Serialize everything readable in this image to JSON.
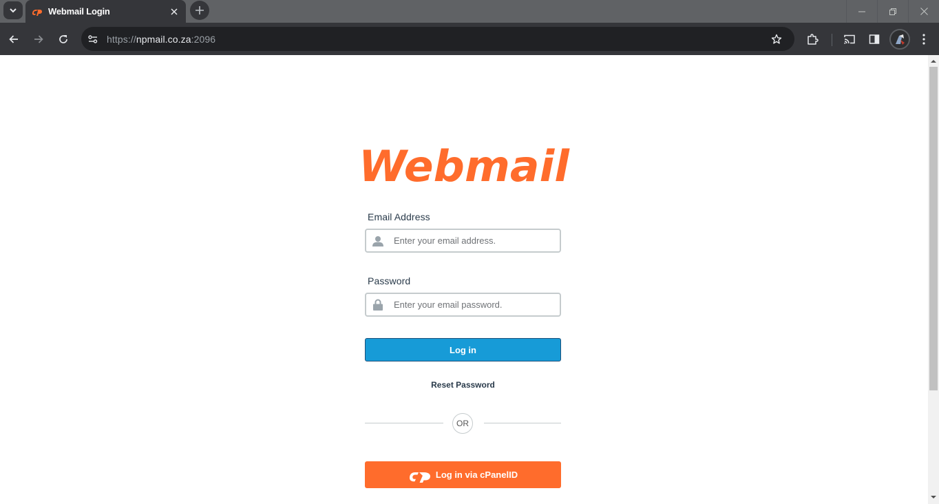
{
  "browser": {
    "tab_title": "Webmail Login",
    "url_scheme": "https://",
    "url_host": "npmail.co.za",
    "url_port": ":2096"
  },
  "page": {
    "logo_text": "Webmail",
    "email_label": "Email Address",
    "email_placeholder": "Enter your email address.",
    "password_label": "Password",
    "password_placeholder": "Enter your email password.",
    "login_button": "Log in",
    "reset_link": "Reset Password",
    "or_text": "OR",
    "cpanelid_button": "Log in via cPanelID"
  },
  "colors": {
    "brand_orange": "#ff6c2c",
    "login_blue": "#179bd7",
    "chrome_dark": "#35363a"
  },
  "icons": [
    "tab-search-icon",
    "cpanel-favicon",
    "close-icon",
    "plus-icon",
    "minimize-icon",
    "restore-icon",
    "window-close-icon",
    "back-icon",
    "forward-icon",
    "reload-icon",
    "site-info-icon",
    "bookmark-star-icon",
    "extensions-icon",
    "cast-icon",
    "side-panel-icon",
    "menu-dots-icon",
    "user-icon",
    "lock-icon",
    "cpanel-logo-icon"
  ]
}
